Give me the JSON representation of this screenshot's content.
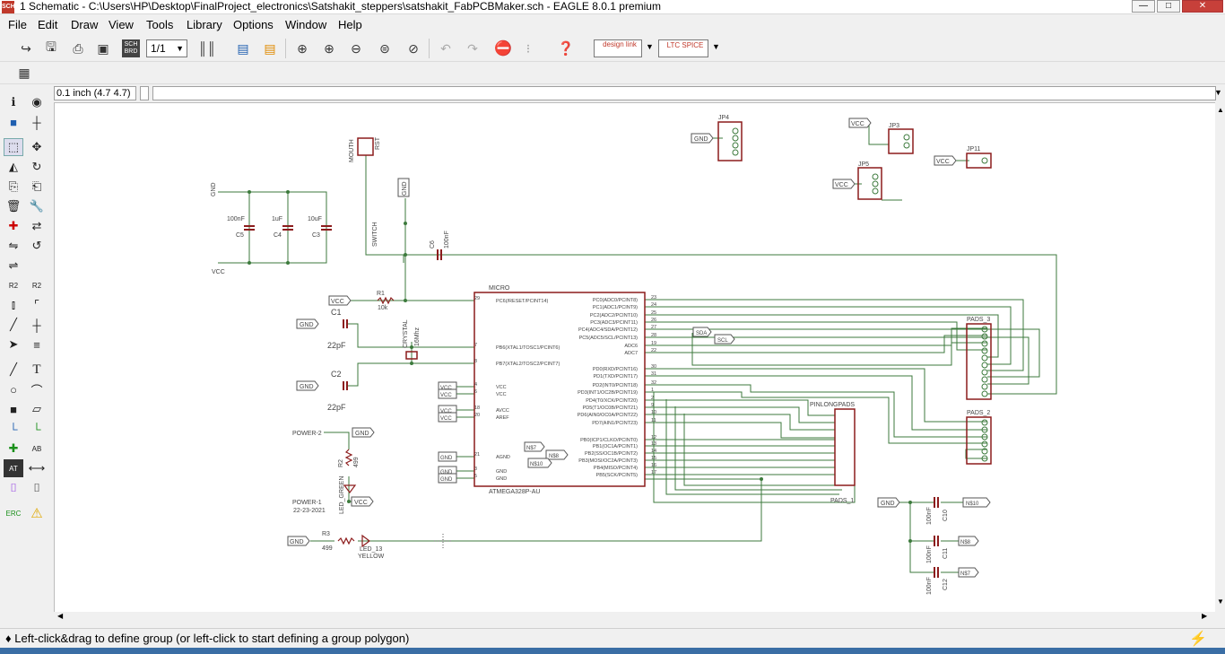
{
  "window": {
    "title": "1 Schematic - C:\\Users\\HP\\Desktop\\FinalProject_electronics\\Satshakit_steppers\\satshakit_FabPCBMaker.sch - EAGLE 8.0.1 premium",
    "minimize": "—",
    "maximize": "□",
    "close": "✕"
  },
  "menu": [
    "File",
    "Edit",
    "Draw",
    "View",
    "Tools",
    "Library",
    "Options",
    "Window",
    "Help"
  ],
  "toolbar": {
    "sheet_select": "1/1",
    "sch_brd": "SCH BRD",
    "designlink": "design link",
    "ltspice": "LTC SPICE"
  },
  "command": {
    "coordinates": "0.1 inch (4.7 4.7)",
    "input_value": ""
  },
  "status": {
    "message": "♦ Left-click&drag to define group (or left-click to start defining a group polygon)"
  },
  "schematic": {
    "jp4": "JP4",
    "jp3": "JP3",
    "jp5": "JP5",
    "jp11": "JP11",
    "gnd": "GND",
    "vcc": "VCC",
    "mouth": "MOUTH",
    "rst": "RST",
    "c5": "C5",
    "c4": "C4",
    "c3": "C3",
    "c5_val": "100nF",
    "c4_val": "1uF",
    "c3_val": "10uF",
    "switch": "SWITCH",
    "c6": "C6",
    "c6_val": "100nF",
    "r1": "R1",
    "r1_val": "10k",
    "c1": "C1",
    "c2": "C2",
    "c1_val": "22pF",
    "c2_val": "22pF",
    "crystal": "CRYSTAL",
    "crystal_val": "16Mhz",
    "micro": "MICRO",
    "micro_val": "ATMEGA328P-AU",
    "pins_left": [
      "PC6(/RESET/PCINT14)",
      "PB6(XTAL1/TOSC1/PCINT6)",
      "PB7(XTAL2/TOSC2/PCINT7)",
      "VCC",
      "VCC",
      "AVCC",
      "AREF",
      "AGND",
      "GND",
      "GND"
    ],
    "pins_left_nums": [
      "29",
      "7",
      "8",
      "4",
      "6",
      "18",
      "20",
      "21",
      "3",
      "5"
    ],
    "pins_right": [
      "PC0(ADC0/PCINT8)",
      "PC1(ADC1/PCINT9)",
      "PC2(ADC2/PCINT10)",
      "PC3(ADC3/PCINT11)",
      "PC4(ADC4/SDA/PCINT12)",
      "PC5(ADC5/SCL/PCINT13)",
      "ADC6",
      "ADC7",
      "PD0(RXD/PCINT16)",
      "PD1(TXD/PCINT17)",
      "PD2(INT0/PCINT18)",
      "PD3(INT1/OC2B/PCINT19)",
      "PD4(T0/XCK/PCINT20)",
      "PD5(T1/OC0B/PCINT21)",
      "PD6(AIN0/OC0A/PCINT22)",
      "PD7(AIN1/PCINT23)",
      "PB0(ICP1/CLKO/PCINT0)",
      "PB1(OC1A/PCINT1)",
      "PB2(SS/OC1B/PCINT2)",
      "PB3(MOSI/OC2A/PCINT3)",
      "PB4(MISO/PCINT4)",
      "PB5(SCK/PCINT5)"
    ],
    "pins_right_nums": [
      "23",
      "24",
      "25",
      "26",
      "27",
      "28",
      "19",
      "22",
      "30",
      "31",
      "32",
      "1",
      "2",
      "9",
      "10",
      "11",
      "12",
      "13",
      "14",
      "15",
      "16",
      "17"
    ],
    "sda": "SDA",
    "scl": "SCL",
    "pads3": "PADS_3",
    "pads2": "PADS_2",
    "pads1": "PADS_1",
    "pinlong": "PINLONGPADS",
    "n7": "N$7",
    "n8": "N$8",
    "n10": "N$10",
    "power2": "POWER-2",
    "power1": "POWER-1",
    "date": "22-23-2021",
    "r2": "R2",
    "r2_val": "499",
    "r3": "R3",
    "r3_val": "499",
    "led_green": "LED_GREEN",
    "led13": "LED_13",
    "yellow": "YELLOW",
    "c10": "C10",
    "c11": "C11",
    "c12": "C12",
    "c10_val": "100nF",
    "c11_val": "100nF",
    "c12_val": "100nF"
  }
}
